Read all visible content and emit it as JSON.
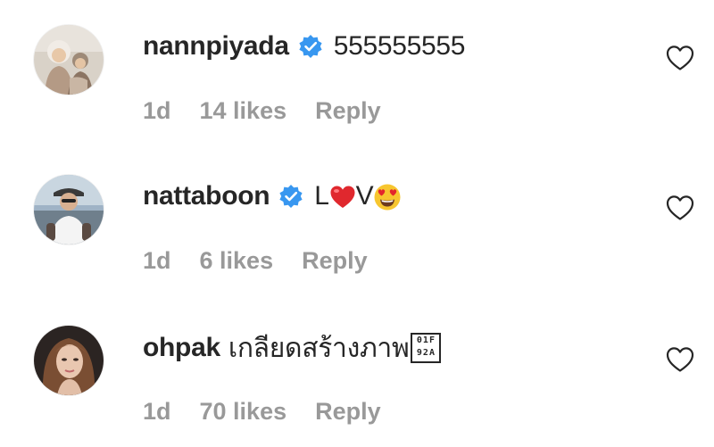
{
  "comments": [
    {
      "username": "nannpiyada",
      "verified": true,
      "text": "555555555",
      "time": "1d",
      "likes": "14 likes",
      "reply": "Reply"
    },
    {
      "username": "nattaboon",
      "verified": true,
      "text_prefix": "L",
      "text_mid": "V",
      "time": "1d",
      "likes": "6 likes",
      "reply": "Reply"
    },
    {
      "username": "ohpak",
      "verified": false,
      "text": "เกลียดสร้างภาพ",
      "time": "1d",
      "likes": "70 likes",
      "reply": "Reply"
    }
  ],
  "icons": {
    "verified": "verified-badge-icon",
    "like": "heart-outline-icon"
  },
  "colors": {
    "verified_blue": "#3897f0",
    "meta_gray": "#999999",
    "text": "#262626"
  }
}
